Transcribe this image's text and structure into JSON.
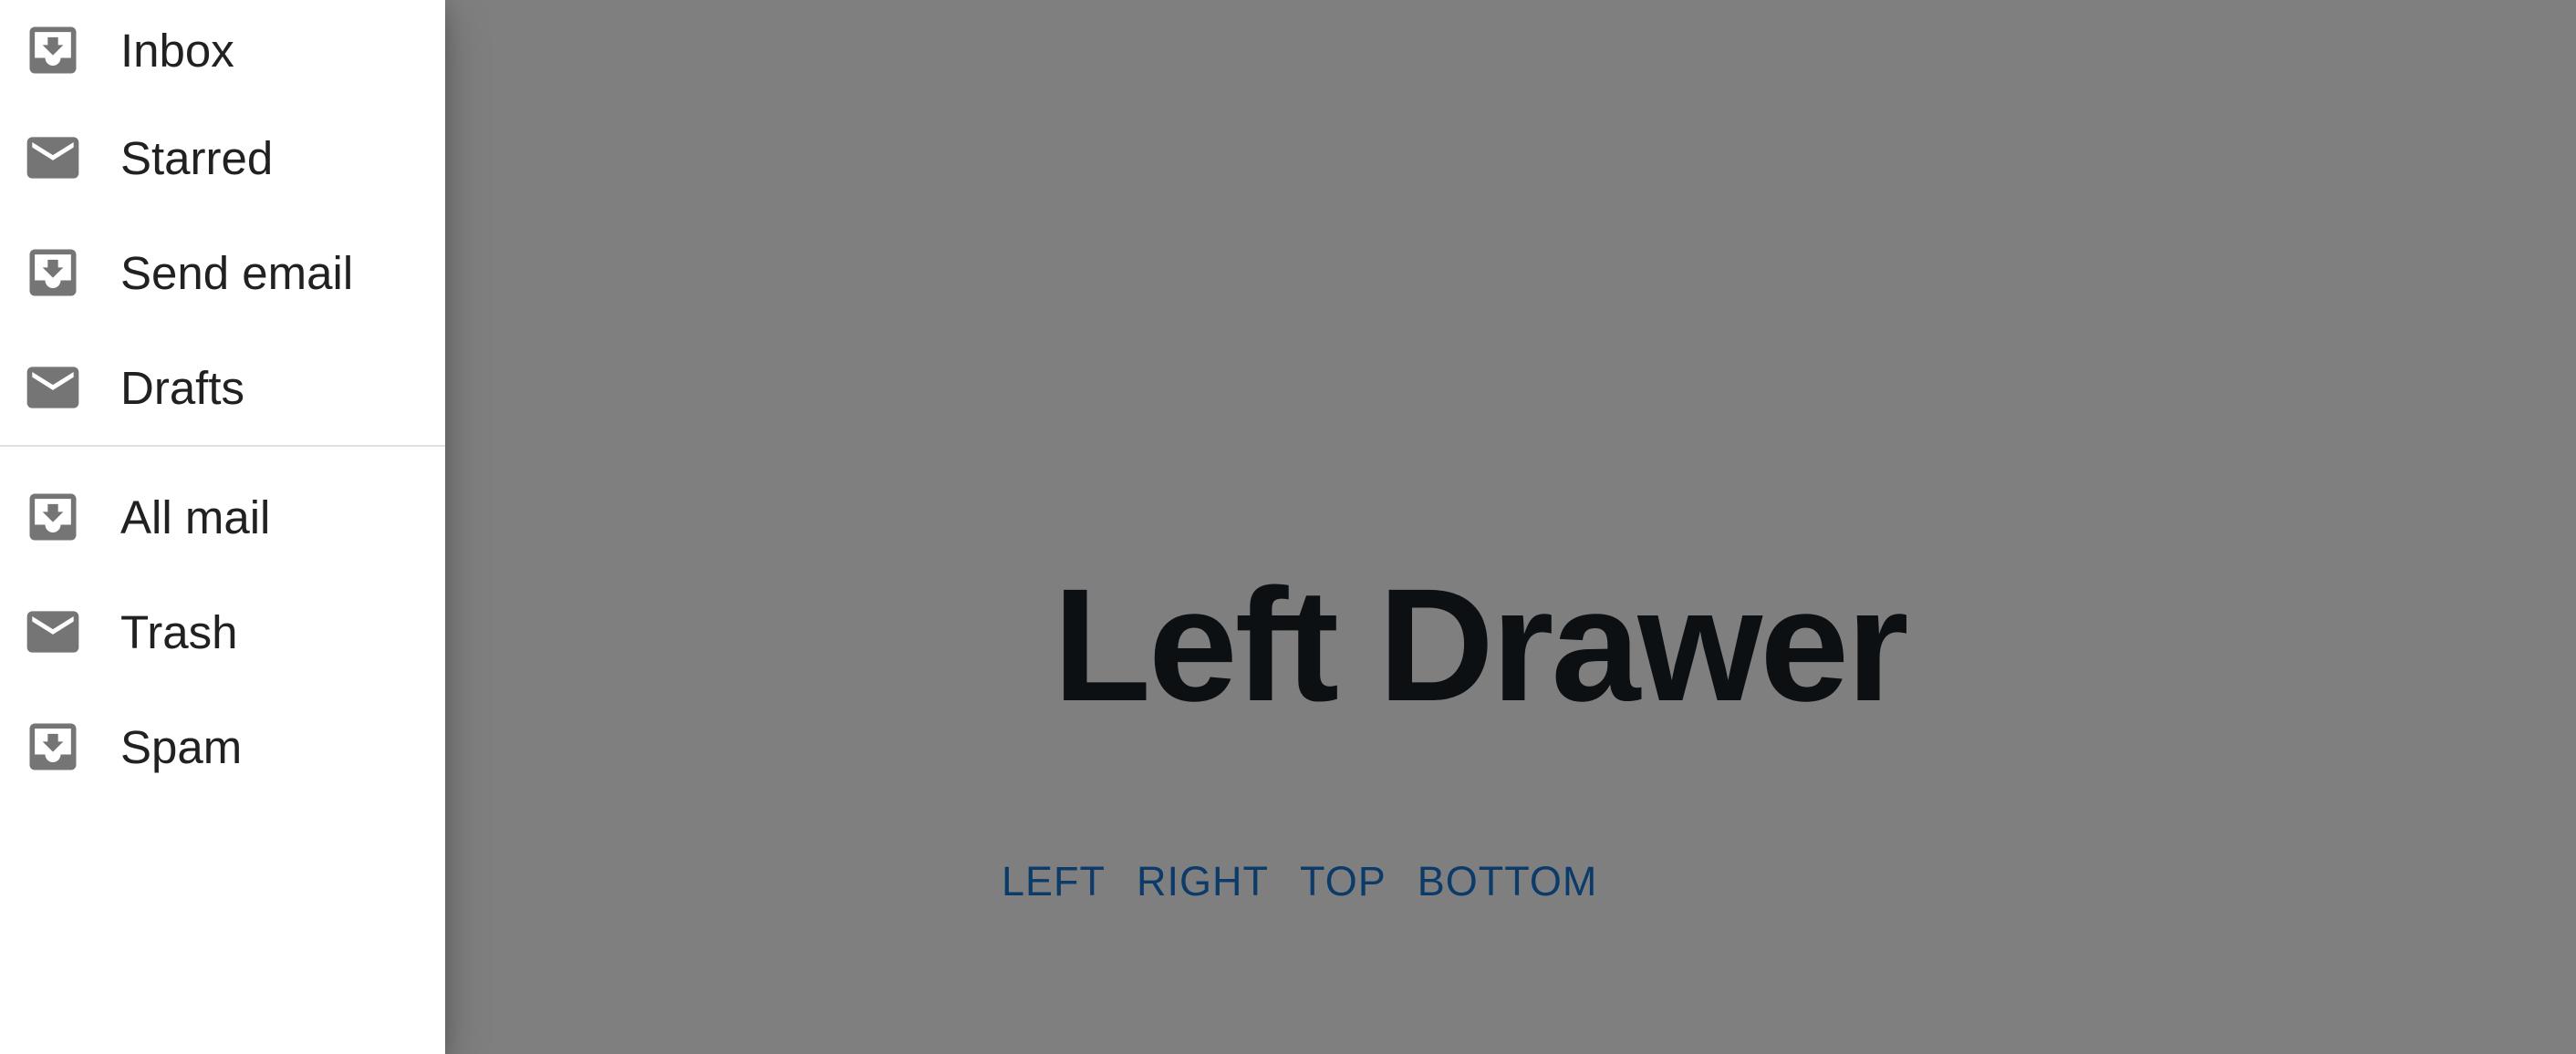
{
  "drawer": {
    "group1": [
      {
        "label": "Inbox",
        "icon": "inbox-icon"
      },
      {
        "label": "Starred",
        "icon": "mail-icon"
      },
      {
        "label": "Send email",
        "icon": "inbox-icon"
      },
      {
        "label": "Drafts",
        "icon": "mail-icon"
      }
    ],
    "group2": [
      {
        "label": "All mail",
        "icon": "inbox-icon"
      },
      {
        "label": "Trash",
        "icon": "mail-icon"
      },
      {
        "label": "Spam",
        "icon": "inbox-icon"
      }
    ]
  },
  "main": {
    "title": "Left Drawer",
    "buttons": {
      "left": "LEFT",
      "right": "RIGHT",
      "top": "TOP",
      "bottom": "BOTTOM"
    }
  },
  "colors": {
    "backdrop": "rgba(0,0,0,0.5)",
    "button_text": "#1976d2",
    "title_text": "#1a2027",
    "icon": "#757575"
  }
}
